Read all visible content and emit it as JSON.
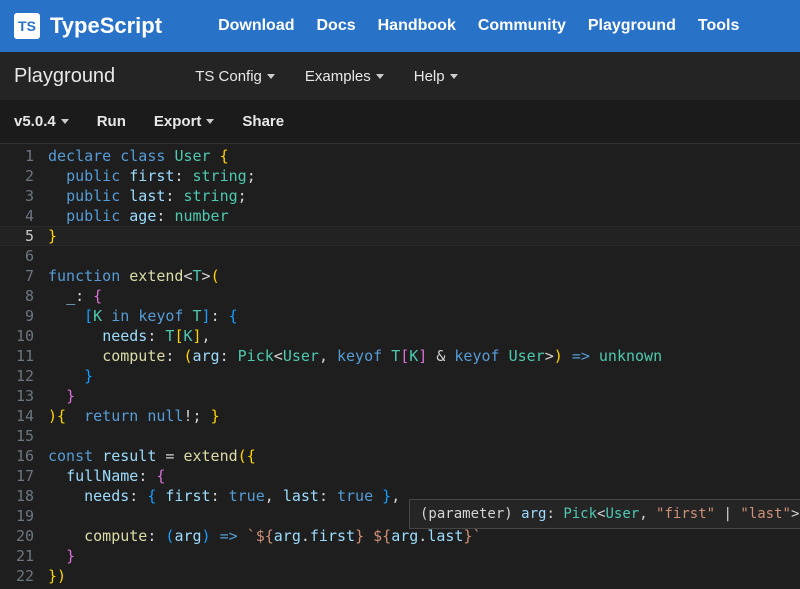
{
  "brand": {
    "logo": "TS",
    "name": "TypeScript"
  },
  "topnav": [
    "Download",
    "Docs",
    "Handbook",
    "Community",
    "Playground",
    "Tools"
  ],
  "subtitle": "Playground",
  "submenu": [
    {
      "label": "TS Config",
      "caret": true
    },
    {
      "label": "Examples",
      "caret": true
    },
    {
      "label": "Help",
      "caret": true
    }
  ],
  "toolbar": [
    {
      "label": "v5.0.4",
      "caret": true
    },
    {
      "label": "Run",
      "caret": false
    },
    {
      "label": "Export",
      "caret": true
    },
    {
      "label": "Share",
      "caret": false
    }
  ],
  "editor": {
    "activeLine": 5,
    "lineCount": 22,
    "lines": {
      "1": [
        [
          "k",
          "declare"
        ],
        [
          "c",
          " "
        ],
        [
          "k",
          "class"
        ],
        [
          "c",
          " "
        ],
        [
          "t",
          "User"
        ],
        [
          "c",
          " "
        ],
        [
          "br",
          "{"
        ]
      ],
      "2": [
        [
          "c",
          "  "
        ],
        [
          "k",
          "public"
        ],
        [
          "c",
          " "
        ],
        [
          "v",
          "first"
        ],
        [
          "p",
          ":"
        ],
        [
          "c",
          " "
        ],
        [
          "t",
          "string"
        ],
        [
          "p",
          ";"
        ]
      ],
      "3": [
        [
          "c",
          "  "
        ],
        [
          "k",
          "public"
        ],
        [
          "c",
          " "
        ],
        [
          "v",
          "last"
        ],
        [
          "p",
          ":"
        ],
        [
          "c",
          " "
        ],
        [
          "t",
          "string"
        ],
        [
          "p",
          ";"
        ]
      ],
      "4": [
        [
          "c",
          "  "
        ],
        [
          "k",
          "public"
        ],
        [
          "c",
          " "
        ],
        [
          "v",
          "age"
        ],
        [
          "p",
          ":"
        ],
        [
          "c",
          " "
        ],
        [
          "t",
          "number"
        ]
      ],
      "5": [
        [
          "br",
          "}"
        ]
      ],
      "6": [
        [
          "c",
          ""
        ]
      ],
      "7": [
        [
          "k",
          "function"
        ],
        [
          "c",
          " "
        ],
        [
          "fn",
          "extend"
        ],
        [
          "p",
          "<"
        ],
        [
          "t",
          "T"
        ],
        [
          "p",
          ">"
        ],
        [
          "br",
          "("
        ]
      ],
      "8": [
        [
          "c",
          "  "
        ],
        [
          "v",
          "_"
        ],
        [
          "p",
          ":"
        ],
        [
          "c",
          " "
        ],
        [
          "br2",
          "{"
        ]
      ],
      "9": [
        [
          "c",
          "    "
        ],
        [
          "br3",
          "["
        ],
        [
          "t",
          "K"
        ],
        [
          "c",
          " "
        ],
        [
          "k",
          "in"
        ],
        [
          "c",
          " "
        ],
        [
          "k",
          "keyof"
        ],
        [
          "c",
          " "
        ],
        [
          "t",
          "T"
        ],
        [
          "br3",
          "]"
        ],
        [
          "p",
          ":"
        ],
        [
          "c",
          " "
        ],
        [
          "br3",
          "{"
        ]
      ],
      "10": [
        [
          "c",
          "      "
        ],
        [
          "v",
          "needs"
        ],
        [
          "p",
          ":"
        ],
        [
          "c",
          " "
        ],
        [
          "t",
          "T"
        ],
        [
          "br",
          "["
        ],
        [
          "t",
          "K"
        ],
        [
          "br",
          "]"
        ],
        [
          "p",
          ","
        ]
      ],
      "11": [
        [
          "c",
          "      "
        ],
        [
          "fn",
          "compute"
        ],
        [
          "p",
          ":"
        ],
        [
          "c",
          " "
        ],
        [
          "br",
          "("
        ],
        [
          "v",
          "arg"
        ],
        [
          "p",
          ":"
        ],
        [
          "c",
          " "
        ],
        [
          "t",
          "Pick"
        ],
        [
          "p",
          "<"
        ],
        [
          "t",
          "User"
        ],
        [
          "p",
          ","
        ],
        [
          "c",
          " "
        ],
        [
          "k",
          "keyof"
        ],
        [
          "c",
          " "
        ],
        [
          "t",
          "T"
        ],
        [
          "br2",
          "["
        ],
        [
          "t",
          "K"
        ],
        [
          "br2",
          "]"
        ],
        [
          "c",
          " "
        ],
        [
          "p",
          "&"
        ],
        [
          "c",
          " "
        ],
        [
          "k",
          "keyof"
        ],
        [
          "c",
          " "
        ],
        [
          "t",
          "User"
        ],
        [
          "p",
          ">"
        ],
        [
          "br",
          ")"
        ],
        [
          "c",
          " "
        ],
        [
          "k",
          "=>"
        ],
        [
          "c",
          " "
        ],
        [
          "t",
          "unknown"
        ]
      ],
      "12": [
        [
          "c",
          "    "
        ],
        [
          "br3",
          "}"
        ]
      ],
      "13": [
        [
          "c",
          "  "
        ],
        [
          "br2",
          "}"
        ]
      ],
      "14": [
        [
          "br",
          ")"
        ],
        [
          "br",
          "{"
        ],
        [
          "c",
          "  "
        ],
        [
          "k",
          "return"
        ],
        [
          "c",
          " "
        ],
        [
          "k",
          "null"
        ],
        [
          "p",
          "!"
        ],
        [
          "p",
          ";"
        ],
        [
          "c",
          " "
        ],
        [
          "br",
          "}"
        ]
      ],
      "15": [
        [
          "c",
          ""
        ]
      ],
      "16": [
        [
          "k",
          "const"
        ],
        [
          "c",
          " "
        ],
        [
          "v",
          "result"
        ],
        [
          "c",
          " "
        ],
        [
          "p",
          "="
        ],
        [
          "c",
          " "
        ],
        [
          "fn",
          "extend"
        ],
        [
          "br",
          "("
        ],
        [
          "br",
          "{"
        ]
      ],
      "17": [
        [
          "c",
          "  "
        ],
        [
          "v",
          "fullName"
        ],
        [
          "p",
          ":"
        ],
        [
          "c",
          " "
        ],
        [
          "br2",
          "{"
        ]
      ],
      "18": [
        [
          "c",
          "    "
        ],
        [
          "v",
          "needs"
        ],
        [
          "p",
          ":"
        ],
        [
          "c",
          " "
        ],
        [
          "br3",
          "{"
        ],
        [
          "c",
          " "
        ],
        [
          "v",
          "first"
        ],
        [
          "p",
          ":"
        ],
        [
          "c",
          " "
        ],
        [
          "k",
          "true"
        ],
        [
          "p",
          ","
        ],
        [
          "c",
          " "
        ],
        [
          "v",
          "last"
        ],
        [
          "p",
          ":"
        ],
        [
          "c",
          " "
        ],
        [
          "k",
          "true"
        ],
        [
          "c",
          " "
        ],
        [
          "br3",
          "}"
        ],
        [
          "p",
          ","
        ]
      ],
      "19": [
        [
          "c",
          ""
        ]
      ],
      "20": [
        [
          "c",
          "    "
        ],
        [
          "fn",
          "compute"
        ],
        [
          "p",
          ":"
        ],
        [
          "c",
          " "
        ],
        [
          "br3",
          "("
        ],
        [
          "v",
          "arg"
        ],
        [
          "br3",
          ")"
        ],
        [
          "c",
          " "
        ],
        [
          "k",
          "=>"
        ],
        [
          "c",
          " "
        ],
        [
          "s",
          "`"
        ],
        [
          "s",
          "${"
        ],
        [
          "v",
          "arg"
        ],
        [
          "p",
          "."
        ],
        [
          "v",
          "first"
        ],
        [
          "s",
          "}"
        ],
        [
          "s",
          " "
        ],
        [
          "s",
          "${"
        ],
        [
          "v",
          "arg"
        ],
        [
          "p",
          "."
        ],
        [
          "v",
          "last"
        ],
        [
          "s",
          "}"
        ],
        [
          "s",
          "`"
        ]
      ],
      "21": [
        [
          "c",
          "  "
        ],
        [
          "br2",
          "}"
        ]
      ],
      "22": [
        [
          "br",
          "}"
        ],
        [
          "br",
          ")"
        ]
      ]
    }
  },
  "hover": {
    "prefix": "(parameter) ",
    "name": "arg",
    "colon": ": ",
    "type": "Pick",
    "open": "<",
    "user": "User",
    "comma": ", ",
    "s1": "\"first\"",
    "pipe": " | ",
    "s2": "\"last\"",
    "close": ">"
  }
}
